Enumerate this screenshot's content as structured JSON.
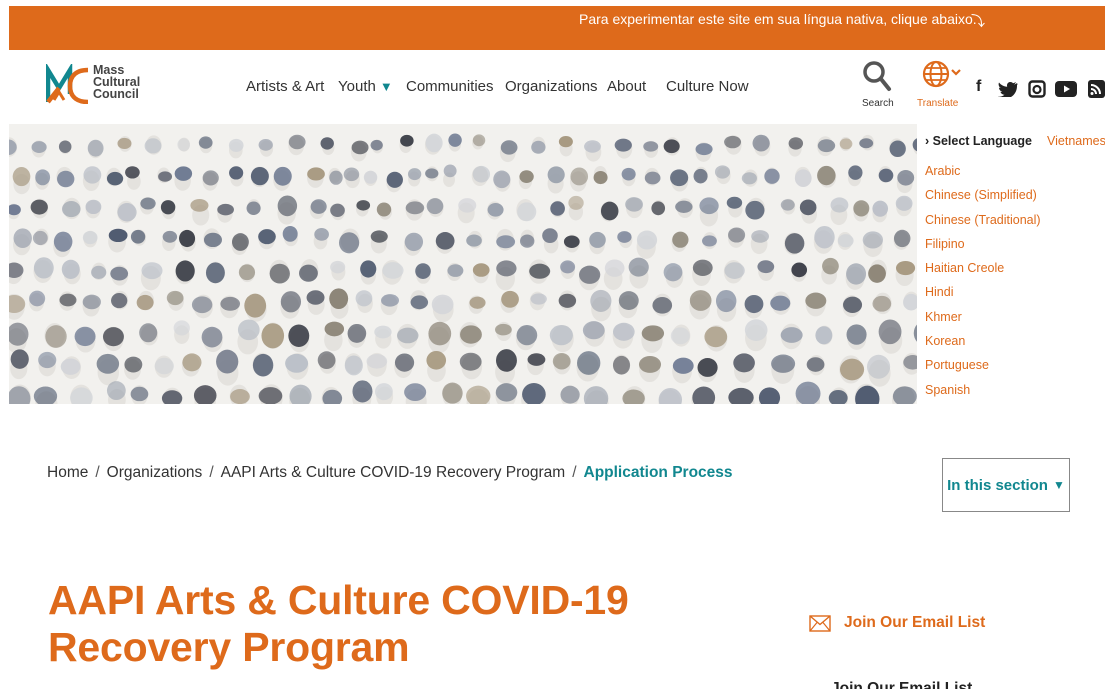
{
  "banner": {
    "message": "Para experimentar este site em sua língua nativa, clique abaixo.",
    "arrow": "⤵"
  },
  "logo": {
    "line1": "Mass",
    "line2": "Cultural",
    "line3": "Council"
  },
  "nav": {
    "items": [
      {
        "label": "Artists & Art"
      },
      {
        "label": "Youth",
        "caret": "▼"
      },
      {
        "label": "Communities"
      },
      {
        "label": "Organizations"
      },
      {
        "label": "About"
      },
      {
        "label": "Culture Now"
      }
    ]
  },
  "utilities": {
    "search_label": "Search",
    "translate_label": "Translate",
    "social": [
      "facebook-icon",
      "twitter-icon",
      "instagram-icon",
      "youtube-icon",
      "rss-icon"
    ]
  },
  "language_menu": {
    "heading": "› Select Language",
    "current": "Vietnamese",
    "languages": [
      "Arabic",
      "Chinese (Simplified)",
      "Chinese (Traditional)",
      "Filipino",
      "Haitian Creole",
      "Hindi",
      "Khmer",
      "Korean",
      "Portuguese",
      "Spanish"
    ]
  },
  "breadcrumb": {
    "items": [
      "Home",
      "Organizations",
      "AAPI Arts & Culture COVID-19 Recovery Program"
    ],
    "current": "Application Process",
    "separator": "/"
  },
  "section_button": {
    "label": "In this section",
    "caret": "▼"
  },
  "page": {
    "title_line1": "AAPI Arts & Culture COVID-19",
    "title_line2": "Recovery Program"
  },
  "sidebar": {
    "email_link": "Join Our Email List",
    "email_heading": "Join Our Email List"
  },
  "colors": {
    "brand_orange": "#de6a1b",
    "teal": "#11878f",
    "hero_bg": "#f2f1ee"
  }
}
